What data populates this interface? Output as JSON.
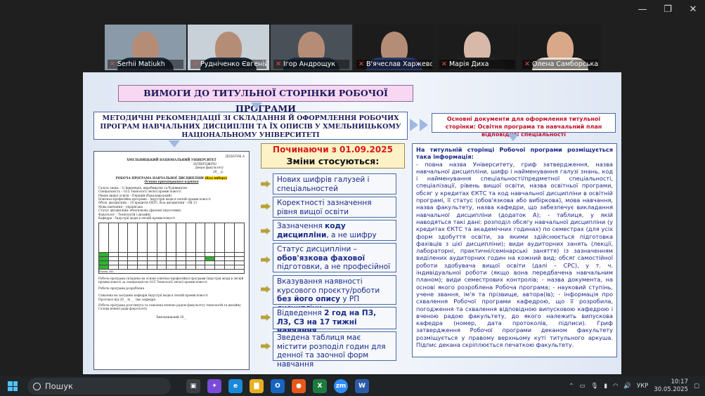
{
  "window": {
    "minimize": "—",
    "maximize": "❐",
    "close": "✕"
  },
  "participants": [
    {
      "name": "Serhii Matiukh"
    },
    {
      "name": "Рудніченко Євгеній"
    },
    {
      "name": "Ігор Андрощук"
    },
    {
      "name": "В'ячеслав Харжевсь..."
    },
    {
      "name": "Марія Диха"
    },
    {
      "name": "Олена Самборська"
    }
  ],
  "slide": {
    "title": "ВИМОГИ ДО ТИТУЛЬНОЇ СТОРІНКИ РОБОЧОЇ ПРОГРАМИ",
    "method": "МЕТОДИЧНІ РЕКОМЕНДАЦІЇ ЗІ СКЛАДАННЯ Й ОФОРМЛЕННЯ РОБОЧИХ ПРОГРАМ НАВЧАЛЬНИХ ДИСЦИПЛІН ТА ЇХ ОПИСІВ У ХМЕЛЬНИЦЬКОМУ НАЦІОНАЛЬНОМУ УНІВЕРСИТЕТІ",
    "docs": "Основні документи для оформлення титульної сторінки: Освітня програма та навчальний план відповідної спеціальності",
    "since_line1": "Починаючи з 01.09.2025",
    "since_line2": "Зміни стосуються:",
    "changes": [
      {
        "a": "Нових шифрів галузей і спеціальностей",
        "b": "",
        "c": ""
      },
      {
        "a": "Коректності зазначення рівня вищої освіти",
        "b": "",
        "c": ""
      },
      {
        "a": "Зазначення ",
        "b": "коду дисципліни",
        "c": ", а не шифру"
      },
      {
        "a": "Статус дисципліни – ",
        "b": "обов'язкова фахової",
        "c": " підготовки, а не професійної"
      },
      {
        "a": "Вказування наявності курсового проєкту/роботи ",
        "b": "без його опису",
        "c": " у РП дисципліни"
      },
      {
        "a": "Відведення ",
        "b": "2 год на ПЗ, ЛЗ, СЗ на 17 тижні навчання",
        "c": ""
      },
      {
        "a": "Зведена таблиця має містити розподіл годин для денної та заочної форм навчання",
        "b": "",
        "c": ""
      }
    ],
    "info_heading": "На титульній сторінці Робочої програми розміщується така інформація:",
    "info_body": "- повна назва Університету, гриф затвердження, назва навчальної дисципліни, шифр і найменування галузі знань, код і найменування спеціальності/предметної спеціальності, спеціалізації, рівень вищої освіти, назва освітньої програми, обсяг у кредитах ЄКТС та код навчальної дисципліни в освітній програмі, її статус (обов'язкова або вибіркова), мова навчання, назва факультету, назва кафедри, що забезпечує викладання навчальної дисципліни (додаток А); - таблиця, у якій наводяться такі дані: розподіл обсягу навчальної дисципліни (у кредитах ЄКТС та академічних годинах) по семестрах (для усіх форм здобуття освіти, за якими здійснюється підготовка фахівців з цієї дисципліни); види аудиторних занять (лекції, лабораторні, практичні/семінарські заняття) із зазначенням виділених аудиторних годин на кожний вид; обсяг самостійної роботи здобувача вищої освіти (далі – СРС), у т. ч. індивідуальної роботи (якщо вона передбачена навчальним планом); види семестрових контролів; - назва документа, на основі якого розроблена Робоча програма; - науковий ступінь, учене звання, ім'я та прізвище, автора(ів); - інформація про схвалення Робочої програми кафедрою, що її розробила, погодження та схвалення відповідною випусковою кафедрою і вченою радою факультету, до якого належить випускова кафедра (номер, дата протоколів, підписи). Гриф затвердження Робочої програми деканом факультету розміщується у правому верхньому куті титульного аркуша. Підпис декана скріплюється печаткою факультету."
  },
  "document": {
    "addendum": "ДОДАТОК А",
    "university": "ХМЕЛЬНИЦЬКИЙ НАЦІОНАЛЬНИЙ УНІВЕРСИТЕТ",
    "approve": "ЗАТВЕРДЖУЮ",
    "dean": "Декан факультету",
    "date": "20__ р.",
    "program_title": "РОБОЧА ПРОГРАМА НАВЧАЛЬНОЇ ДИСЦИПЛІНИ",
    "status_tag": "(Код вибору)",
    "subtitle": "Основи проектування взуття",
    "lines": [
      "Галузь знань – G Інженерія, виробництво та будівництво",
      "Спеціальність – G15 Технології легкої промисловості",
      "Рівень вищої освіти – Перший (бакалаврський)",
      "Освітньо-професійна програма – Індустрія моди в легкій промисловості",
      "Обсяг дисципліни – 10 кредитів ЄКТС, Код дисципліни – ОК 11",
      "Мова навчання – українська",
      "Статус дисципліни: обов'язкова (фахової підготовки)",
      "Факультет – Технологій і дизайну",
      "Кафедра – Індустрії моди в легкій промисловості"
    ],
    "total_row": "Разом 300",
    "foot": [
      "Робоча програма складена на основі освітньо-професійної програми Індустрія моди в легкій промисловості за спеціальністю G15 Технології легкої промисловості",
      "Робоча програма розроблена",
      "Схвалена на засіданні кафедри Індустрії моди в легкій промисловості",
      "Протокол від  20__ № __  Зав. кафедри",
      "Робоча програма розглянута та схвалена вченою радою факультету технологій та дизайну",
      "Голова вченої ради факультету",
      "Хмельницький 20__"
    ]
  },
  "taskbar": {
    "search_placeholder": "Пошук",
    "lang": "УКР",
    "time": "10:17",
    "date": "30.05.2025",
    "apps": [
      {
        "name": "task-view",
        "label": "▣",
        "color": "#3a3f44"
      },
      {
        "name": "copilot",
        "label": "✦",
        "color": "#7a4ad8"
      },
      {
        "name": "edge",
        "label": "e",
        "color": "#1a8ad8"
      },
      {
        "name": "explorer",
        "label": "▇",
        "color": "#e8b020"
      },
      {
        "name": "outlook",
        "label": "O",
        "color": "#1565c0"
      },
      {
        "name": "firefox",
        "label": "●",
        "color": "#e8561a"
      },
      {
        "name": "excel",
        "label": "X",
        "color": "#1d7a3f"
      },
      {
        "name": "zoom",
        "label": "zm",
        "color": "#2d8cff"
      },
      {
        "name": "word",
        "label": "W",
        "color": "#2b5aa8"
      }
    ]
  }
}
